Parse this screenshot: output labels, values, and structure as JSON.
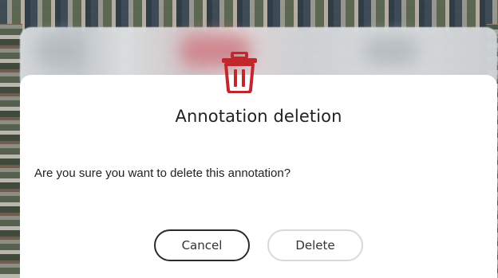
{
  "dialog": {
    "title": "Annotation deletion",
    "message": "Are you sure you want to delete this annotation?",
    "icon": "trash-icon",
    "cancel_label": "Cancel",
    "delete_label": "Delete"
  },
  "colors": {
    "icon_red": "#c0282d",
    "dialog_bg": "#ffffff",
    "text": "#222222",
    "cancel_border": "#2b2b2b",
    "delete_border": "#d9d9d9"
  }
}
